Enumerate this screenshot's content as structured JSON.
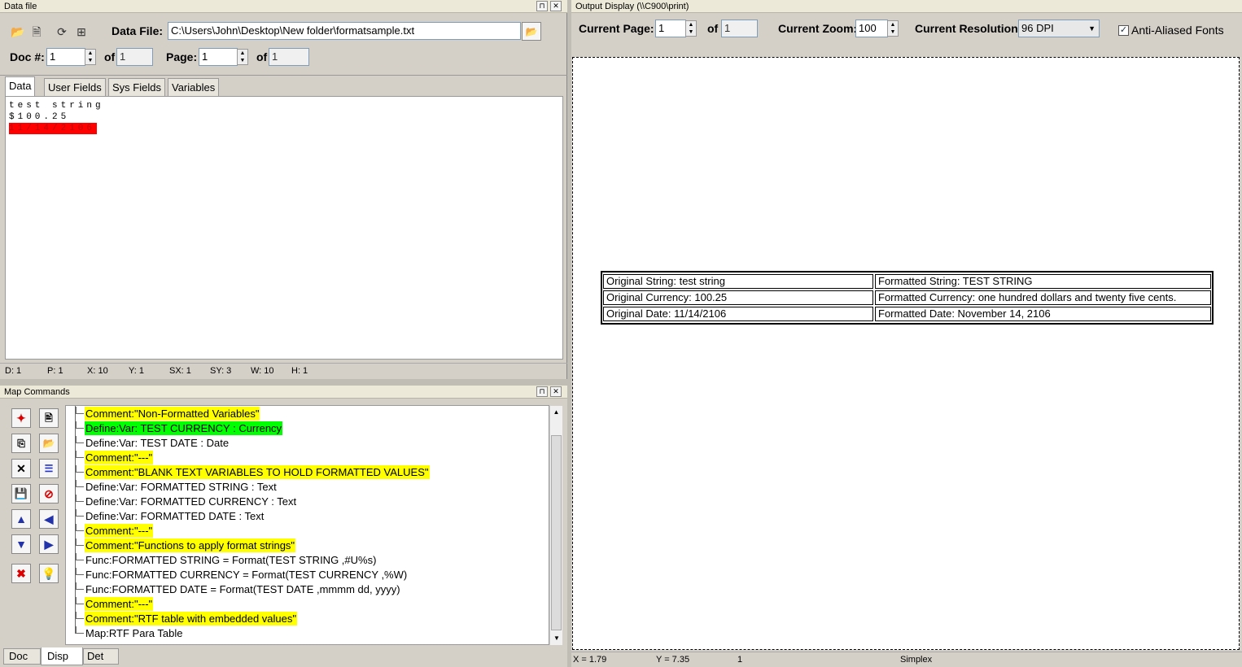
{
  "left_top": {
    "title": "Data file",
    "data_file_label": "Data File:",
    "data_file_path": "C:\\Users\\John\\Desktop\\New folder\\formatsample.txt",
    "doc_label": "Doc #:",
    "doc_value": "1",
    "doc_of_label": "of",
    "doc_total": "1",
    "page_label": "Page:",
    "page_value": "1",
    "page_of_label": "of",
    "page_total": "1",
    "tabs": [
      "Data",
      "User Fields",
      "Sys Fields",
      "Variables"
    ],
    "data_lines": [
      "test string",
      "$100.25",
      "11/14/2106"
    ],
    "status": {
      "d": "D: 1",
      "p": "P: 1",
      "x": "X: 10",
      "y": "Y: 1",
      "sx": "SX: 1",
      "sy": "SY: 3",
      "w": "W: 10",
      "h": "H: 1"
    }
  },
  "map_commands": {
    "title": "Map Commands",
    "rows": [
      {
        "text": "Comment:\"Non-Formatted Variables\"",
        "highlight": "yellow"
      },
      {
        "text": "Define:Var: TEST CURRENCY : Currency",
        "highlight": "green"
      },
      {
        "text": "Define:Var: TEST DATE : Date",
        "highlight": "none"
      },
      {
        "text": "Comment:\"---\"",
        "highlight": "yellow"
      },
      {
        "text": "Comment:\"BLANK TEXT VARIABLES TO HOLD FORMATTED VALUES\"",
        "highlight": "yellow"
      },
      {
        "text": "Define:Var: FORMATTED STRING : Text",
        "highlight": "none"
      },
      {
        "text": "Define:Var: FORMATTED CURRENCY : Text",
        "highlight": "none"
      },
      {
        "text": "Define:Var: FORMATTED DATE : Text",
        "highlight": "none"
      },
      {
        "text": "Comment:\"---\"",
        "highlight": "yellow"
      },
      {
        "text": "Comment:\"Functions to apply format strings\"",
        "highlight": "yellow"
      },
      {
        "text": "Func:FORMATTED STRING = Format(TEST STRING ,#U%s)",
        "highlight": "none"
      },
      {
        "text": "Func:FORMATTED CURRENCY = Format(TEST CURRENCY ,%W)",
        "highlight": "none"
      },
      {
        "text": "Func:FORMATTED DATE = Format(TEST DATE ,mmmm dd, yyyy)",
        "highlight": "none"
      },
      {
        "text": "Comment:\"---\"",
        "highlight": "yellow"
      },
      {
        "text": "Comment:\"RTF table with embedded values\"",
        "highlight": "yellow"
      },
      {
        "text": "Map:RTF Para Table",
        "highlight": "none"
      }
    ],
    "bottom_tabs": [
      "Doc",
      "Disp",
      "Det"
    ]
  },
  "output": {
    "title": "Output Display (\\\\C900\\print)",
    "current_page_label": "Current Page:",
    "current_page": "1",
    "of_label": "of",
    "total_pages": "1",
    "zoom_label": "Current Zoom:",
    "zoom": "100",
    "resolution_label": "Current Resolution:",
    "resolution": "96 DPI",
    "anti_alias_label": "Anti-Aliased Fonts",
    "table": [
      [
        "Original String: test string",
        "Formatted String: TEST STRING"
      ],
      [
        "Original Currency: 100.25",
        "Formatted Currency:  one hundred dollars and twenty five cents."
      ],
      [
        "Original Date:  11/14/2106",
        "Formatted Date:  November 14, 2106"
      ]
    ],
    "status": {
      "x": "X = 1.79",
      "y": "Y = 7.35",
      "n": "1",
      "mode": "Simplex"
    }
  },
  "colors": {
    "highlight_yellow": "#ffff00",
    "highlight_green": "#00ff00",
    "selected_data": "#ff0000"
  }
}
